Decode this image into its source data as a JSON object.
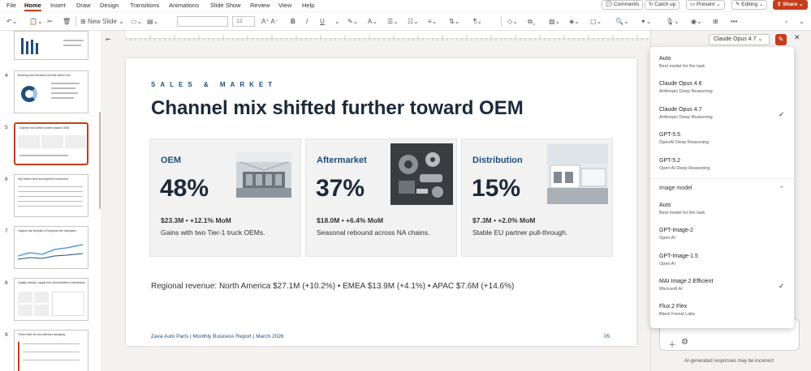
{
  "menu": {
    "items": [
      "File",
      "Home",
      "Insert",
      "Draw",
      "Design",
      "Transitions",
      "Animations",
      "Slide Show",
      "Review",
      "View",
      "Help"
    ],
    "active": "Home"
  },
  "topright": {
    "comments": "Comments",
    "catchup": "Catch up",
    "present": "Present",
    "editing": "Editing",
    "share": "Share"
  },
  "toolbar": {
    "new_slide": "New Slide",
    "font_size": "12"
  },
  "thumbnails": [
    {
      "num": "4",
      "title": "Booking and Elevation and the March mix"
    },
    {
      "num": "5",
      "title": "Channel mix shifted further toward OEM"
    },
    {
      "num": "6",
      "title": "Key March wins and pipeline movement"
    },
    {
      "num": "7",
      "title": "Output rose despite a European line disruption"
    },
    {
      "num": "8",
      "title": "Quality steady; supply risk concentrated in drivetrains"
    },
    {
      "num": "9",
      "title": "Three risks we are actively managing"
    }
  ],
  "slide": {
    "kicker": "SALES & MARKET",
    "title": "Channel mix shifted further toward OEM",
    "cards": [
      {
        "label": "OEM",
        "pct": "48%",
        "metric": "$23.3M • +12.1% MoM",
        "note": "Gains with two Tier-1 truck OEMs."
      },
      {
        "label": "Aftermarket",
        "pct": "37%",
        "metric": "$18.0M • +6.4% MoM",
        "note": "Seasonal rebound across NA chains."
      },
      {
        "label": "Distribution",
        "pct": "15%",
        "metric": "$7.3M • +2.0% MoM",
        "note": "Stable EU partner pull-through."
      }
    ],
    "regional": "Regional revenue: North America $27.1M (+10.2%) • EMEA $13.9M (+4.1%) • APAC $7.6M (+14.6%)",
    "footer": "Zava Auto Parts | Monthly Business Report | March 2026",
    "page_num": "05"
  },
  "copilot": {
    "model_button": "Claude Opus 4.7",
    "text_models": [
      {
        "name": "Auto",
        "sub": "Best model for the task",
        "checked": false
      },
      {
        "name": "Claude Opus 4.6",
        "sub": "Anthropic Deep Reasoning",
        "checked": false
      },
      {
        "name": "Claude Opus 4.7",
        "sub": "Anthropic Deep Reasoning",
        "checked": true
      },
      {
        "name": "GPT-5.5",
        "sub": "OpenAI Deep Reasoning",
        "checked": false
      },
      {
        "name": "GPT-5.2",
        "sub": "Open AI Deep Reasoning",
        "checked": false
      }
    ],
    "image_section": "Image model",
    "image_models": [
      {
        "name": "Auto",
        "sub": "Best model for the task",
        "checked": false
      },
      {
        "name": "GPT-Image-2",
        "sub": "Open AI",
        "checked": false
      },
      {
        "name": "GPT-Image-1.5",
        "sub": "Open AI",
        "checked": false
      },
      {
        "name": "MAI Image 2 Efficient",
        "sub": "Microsoft AI",
        "checked": true
      },
      {
        "name": "Flux.2 Flex",
        "sub": "Black Forest Labs",
        "checked": false
      }
    ],
    "disclaimer": "AI-generated responses may be incorrect"
  }
}
